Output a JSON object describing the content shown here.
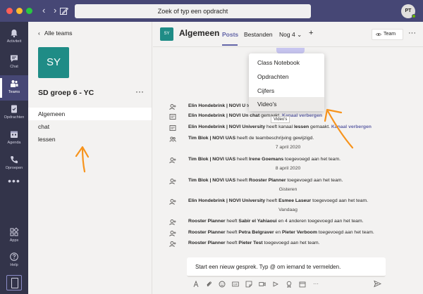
{
  "titlebar": {
    "search_placeholder": "Zoek of typ een opdracht",
    "avatar_initials": "PT"
  },
  "rail": {
    "items": [
      {
        "label": "Activiteit",
        "icon": "bell-icon"
      },
      {
        "label": "Chat",
        "icon": "chat-icon"
      },
      {
        "label": "Teams",
        "icon": "teams-icon"
      },
      {
        "label": "Opdrachten",
        "icon": "assignments-icon"
      },
      {
        "label": "Agenda",
        "icon": "calendar-icon"
      },
      {
        "label": "Oproepen",
        "icon": "phone-icon"
      }
    ],
    "more": "•••",
    "bottom": [
      {
        "label": "Apps",
        "icon": "apps-icon"
      },
      {
        "label": "Help",
        "icon": "help-icon"
      }
    ]
  },
  "teampanel": {
    "back_label": "Alle teams",
    "tile_initials": "SY",
    "team_name": "SD groep 6 - YC",
    "more": "···",
    "channels": [
      "Algemeen",
      "chat",
      "lessen"
    ]
  },
  "header": {
    "tile_initials": "SY",
    "title": "Algemeen",
    "tabs": [
      "Posts",
      "Bestanden",
      "Nog 4"
    ],
    "add": "+",
    "team_button": "Team",
    "more": "···"
  },
  "menu": {
    "items": [
      "Class Notebook",
      "Opdrachten",
      "Cijfers",
      "Video's"
    ],
    "tooltip": "Video's"
  },
  "feed": {
    "events": [
      {
        "parts": [
          [
            "b",
            "Elin Hondebrink | NOVI U"
          ],
          [
            "t",
            " "
          ],
          [
            "b",
            ""
          ],
          [
            "t",
            "toegevoegd aan het team."
          ]
        ],
        "icon": "add-user-icon"
      },
      {
        "parts": [
          [
            "b",
            "Elin Hondebrink | NOVI Un"
          ],
          [
            "t",
            " "
          ],
          [
            "b",
            "chat"
          ],
          [
            "t",
            " gemaakt. "
          ],
          [
            "l",
            "Kanaal verbergen"
          ]
        ],
        "icon": "channel-icon"
      },
      {
        "parts": [
          [
            "b",
            "Elin Hondebrink | NOVI University"
          ],
          [
            "t",
            " heeft kanaal "
          ],
          [
            "b",
            "lessen"
          ],
          [
            "t",
            " gemaakt. "
          ],
          [
            "l",
            "Kanaal verbergen"
          ]
        ],
        "icon": "channel-icon"
      },
      {
        "parts": [
          [
            "b",
            "Tim Blok | NOVI UAS"
          ],
          [
            "t",
            " heeft de teambeschrijving gewijzigd."
          ]
        ],
        "icon": "team-edit-icon"
      },
      {
        "date": "7 april 2020"
      },
      {
        "parts": [
          [
            "b",
            "Tim Blok | NOVI UAS"
          ],
          [
            "t",
            " heeft "
          ],
          [
            "b",
            "Irene Goemans"
          ],
          [
            "t",
            " toegevoegd aan het team."
          ]
        ],
        "icon": "add-user-icon"
      },
      {
        "date": "8 april 2020"
      },
      {
        "parts": [
          [
            "b",
            "Tim Blok | NOVI UAS"
          ],
          [
            "t",
            " heeft "
          ],
          [
            "b",
            "Rooster Planner"
          ],
          [
            "t",
            " toegevoegd aan het team."
          ]
        ],
        "icon": "add-user-icon"
      },
      {
        "date": "Gisteren"
      },
      {
        "parts": [
          [
            "b",
            "Elin Hondebrink | NOVI University"
          ],
          [
            "t",
            " heeft "
          ],
          [
            "b",
            "Esmee Laseur"
          ],
          [
            "t",
            " toegevoegd aan het team."
          ]
        ],
        "icon": "add-user-icon"
      },
      {
        "date": "Vandaag"
      },
      {
        "parts": [
          [
            "b",
            "Rooster Planner"
          ],
          [
            "t",
            " heeft "
          ],
          [
            "b",
            "Sabir el Yahiaoui"
          ],
          [
            "t",
            " en 4 anderen toegevoegd aan het team."
          ]
        ],
        "icon": "add-user-icon"
      },
      {
        "parts": [
          [
            "b",
            "Rooster Planner"
          ],
          [
            "t",
            " heeft "
          ],
          [
            "b",
            "Petra Belgraver"
          ],
          [
            "t",
            " en "
          ],
          [
            "b",
            "Pieter Verboom"
          ],
          [
            "t",
            " toegevoegd aan het team."
          ]
        ],
        "icon": "add-user-icon"
      },
      {
        "parts": [
          [
            "b",
            "Rooster Planner"
          ],
          [
            "t",
            " heeft "
          ],
          [
            "b",
            "Pieter Test"
          ],
          [
            "t",
            " toegevoegd aan het team."
          ]
        ],
        "icon": "add-user-icon"
      }
    ]
  },
  "compose": {
    "placeholder": "Start een nieuw gesprek. Typ @ om iemand te vermelden.",
    "more": "···"
  },
  "colors": {
    "titlebar": "#464775",
    "rail": "#33344a",
    "accent": "#6264a7",
    "team_tile": "#1f8c86",
    "annotation": "#f7941d"
  }
}
